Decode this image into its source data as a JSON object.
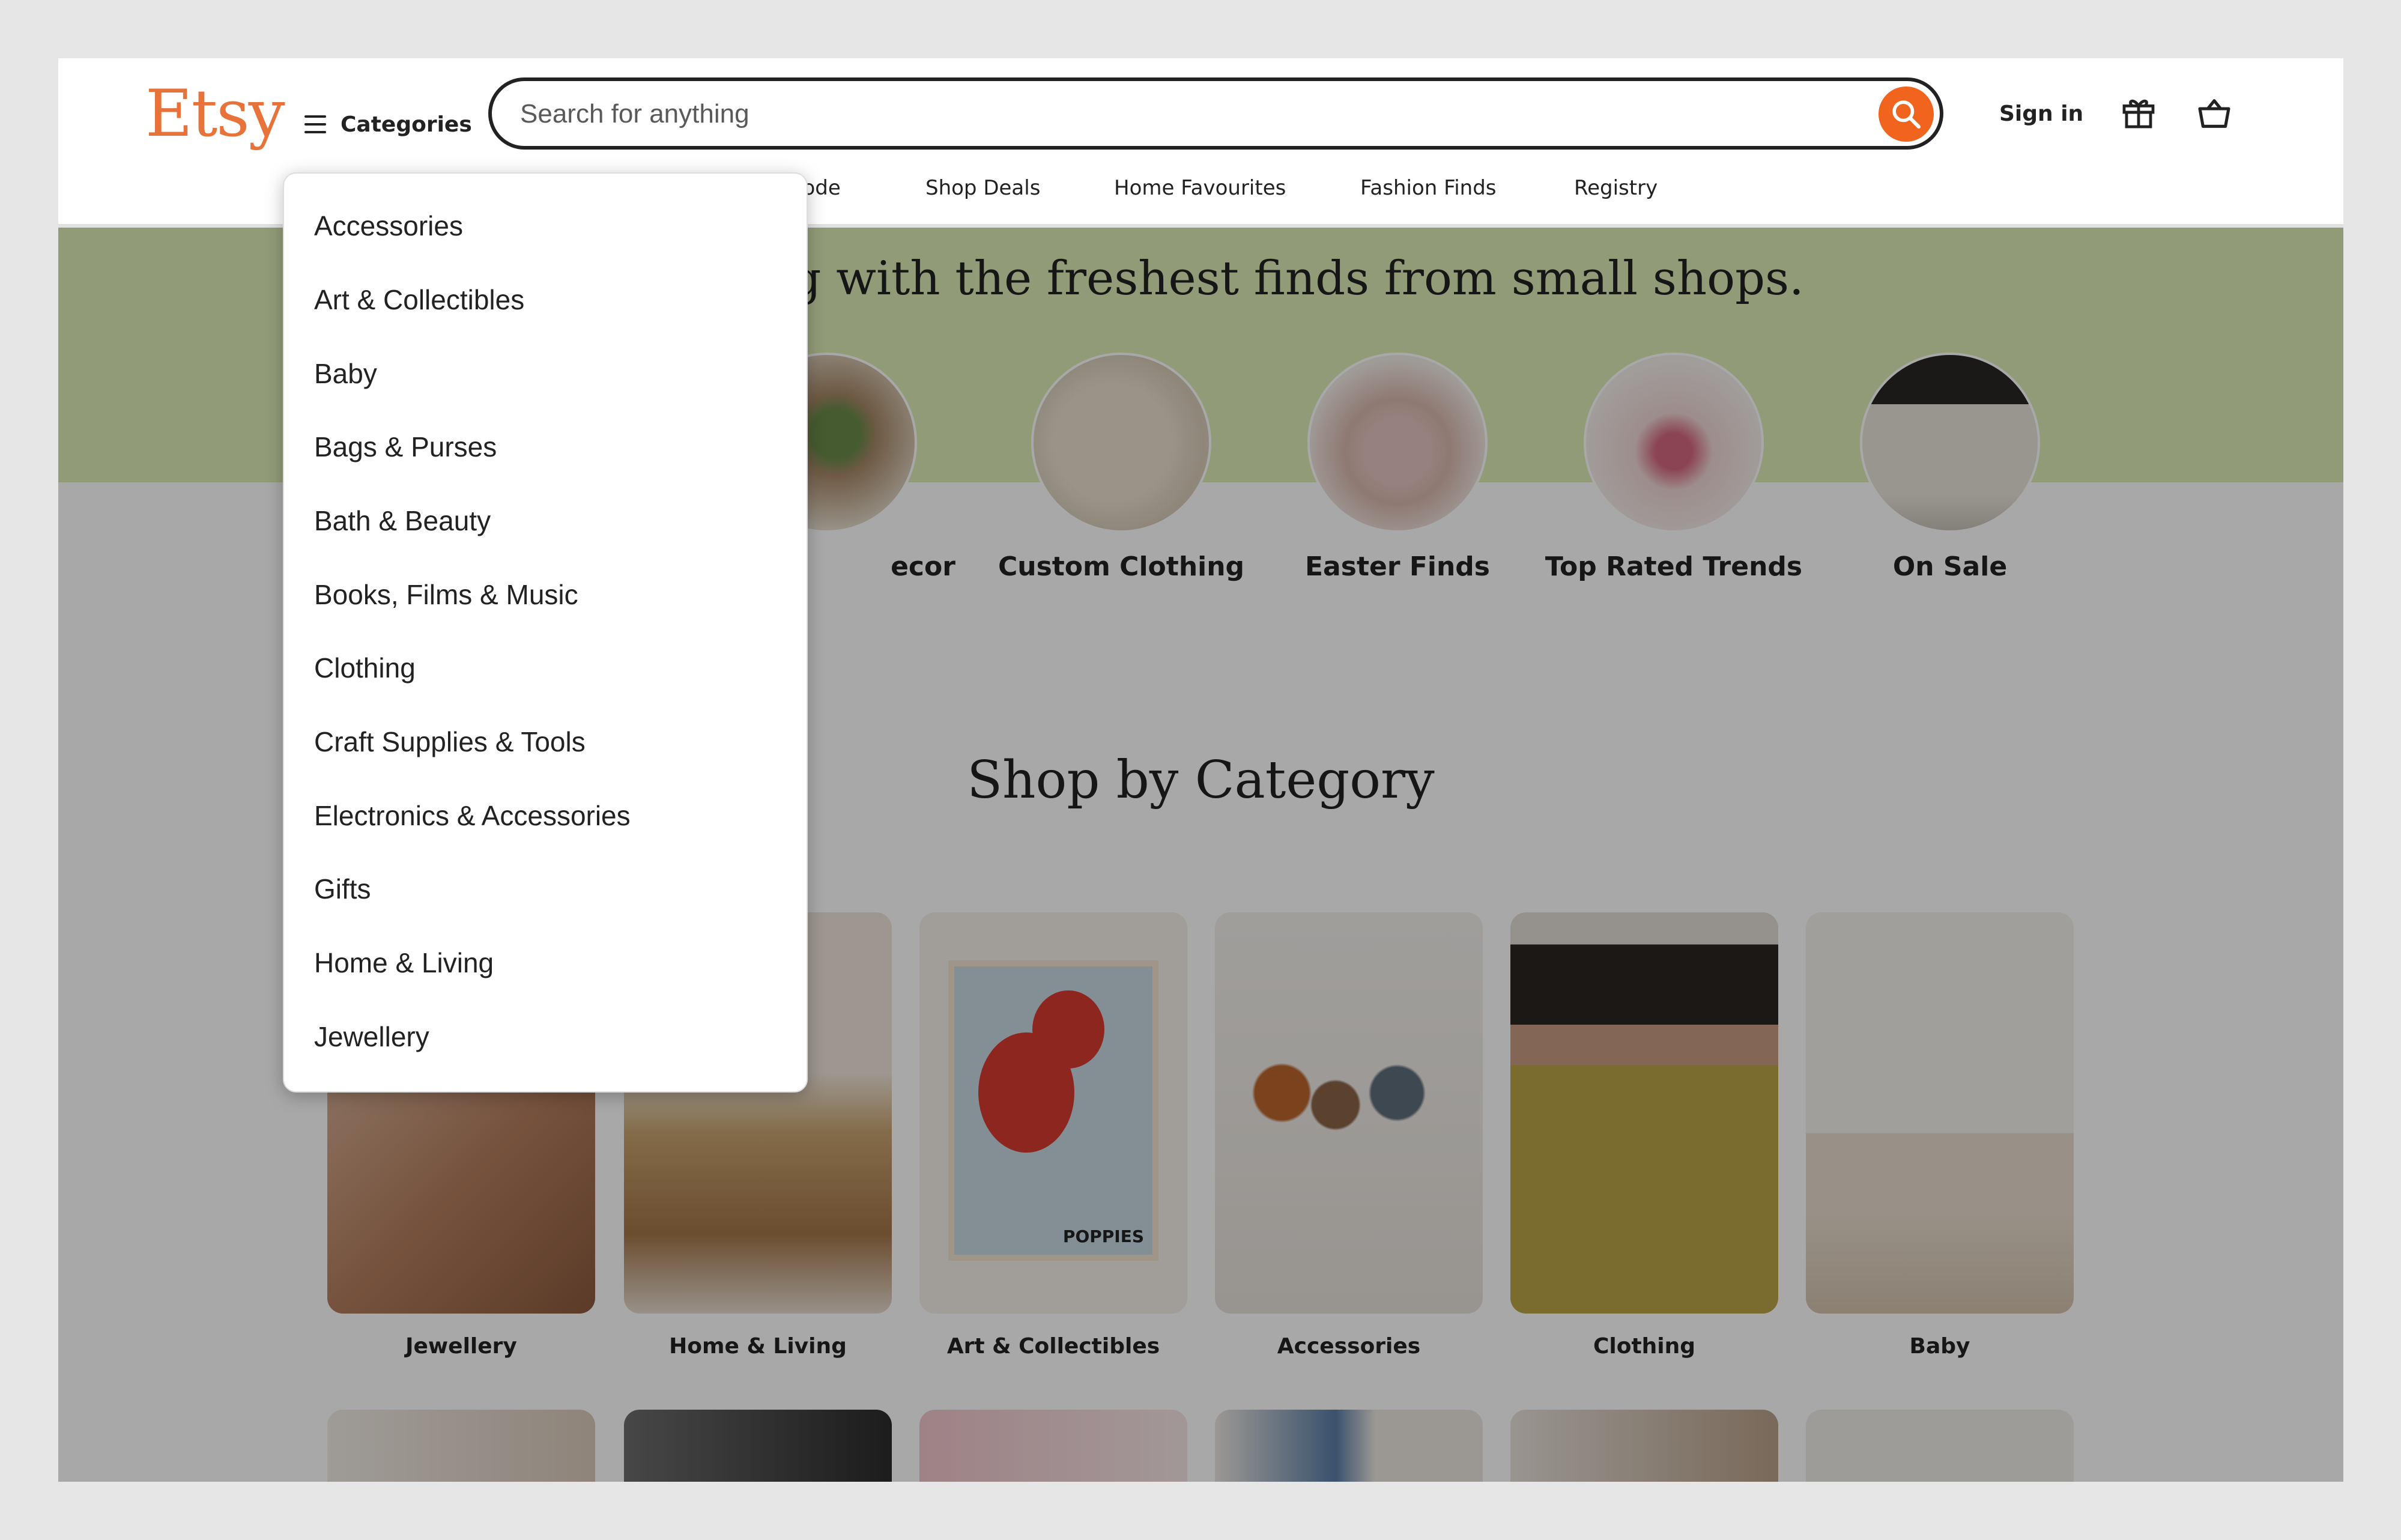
{
  "header": {
    "logo": "Etsy",
    "categories_label": "Categories",
    "search_placeholder": "Search for anything",
    "sign_in": "Sign in",
    "nav": [
      "lode",
      "Shop Deals",
      "Home Favourites",
      "Fashion Finds",
      "Registry"
    ]
  },
  "hero": {
    "text": "spring with the freshest finds from small shops.",
    "circles": [
      {
        "label": "ecor"
      },
      {
        "label": "Custom Clothing"
      },
      {
        "label": "Easter Finds"
      },
      {
        "label": "Top Rated Trends"
      },
      {
        "label": "On Sale"
      }
    ]
  },
  "shop_by_category": {
    "title": "Shop by Category",
    "cards": [
      "Jewellery",
      "Home & Living",
      "Art & Collectibles",
      "Accessories",
      "Clothing",
      "Baby"
    ]
  },
  "art_card_text": "POPPIES",
  "dropdown": {
    "items": [
      "Accessories",
      "Art & Collectibles",
      "Baby",
      "Bags & Purses",
      "Bath & Beauty",
      "Books, Films & Music",
      "Clothing",
      "Craft Supplies & Tools",
      "Electronics & Accessories",
      "Gifts",
      "Home & Living",
      "Jewellery"
    ]
  },
  "colors": {
    "brand": "#e8733a",
    "search_button": "#f1641e",
    "hero_bg": "#dcecb6"
  },
  "icons": [
    "hamburger-icon",
    "search-icon",
    "gift-icon",
    "cart-icon"
  ]
}
